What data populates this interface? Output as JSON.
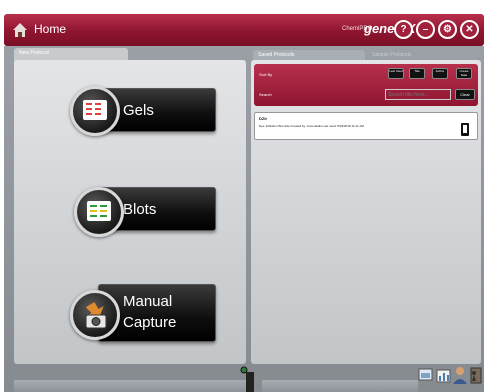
{
  "titlebar": {
    "home_label": "Home",
    "brand_small": "ChemiPRO",
    "brand_main": "genePIX",
    "buttons": [
      {
        "name": "help",
        "glyph": "?"
      },
      {
        "name": "minimize",
        "glyph": "–"
      },
      {
        "name": "settings",
        "glyph": "⚙"
      },
      {
        "name": "close",
        "glyph": "✕"
      }
    ]
  },
  "left_panel": {
    "tab_label": "New Protocol",
    "buttons": [
      {
        "label": "Gels"
      },
      {
        "label": "Blots"
      },
      {
        "label_line1": "Manual",
        "label_line2": "Capture"
      }
    ]
  },
  "right_panel": {
    "tabs": [
      "Saved Protocols",
      "Sample Protocols"
    ],
    "sort_label": "Sort By",
    "search_label": "Search",
    "sort_buttons": [
      "Last Used",
      "Title",
      "Author",
      "Create Date"
    ],
    "search_placeholder": "Search title here...",
    "clear_label": "Clear",
    "items": [
      {
        "name": "DZIr",
        "meta": "Dye:  Ethidium Bromide    Created by:  Armoudalis    Last used:  8/23/2018 11:21 AM"
      }
    ]
  },
  "colors": {
    "accent": "#8e1530",
    "panel": "#d8dadd",
    "background": "#8d9297"
  }
}
